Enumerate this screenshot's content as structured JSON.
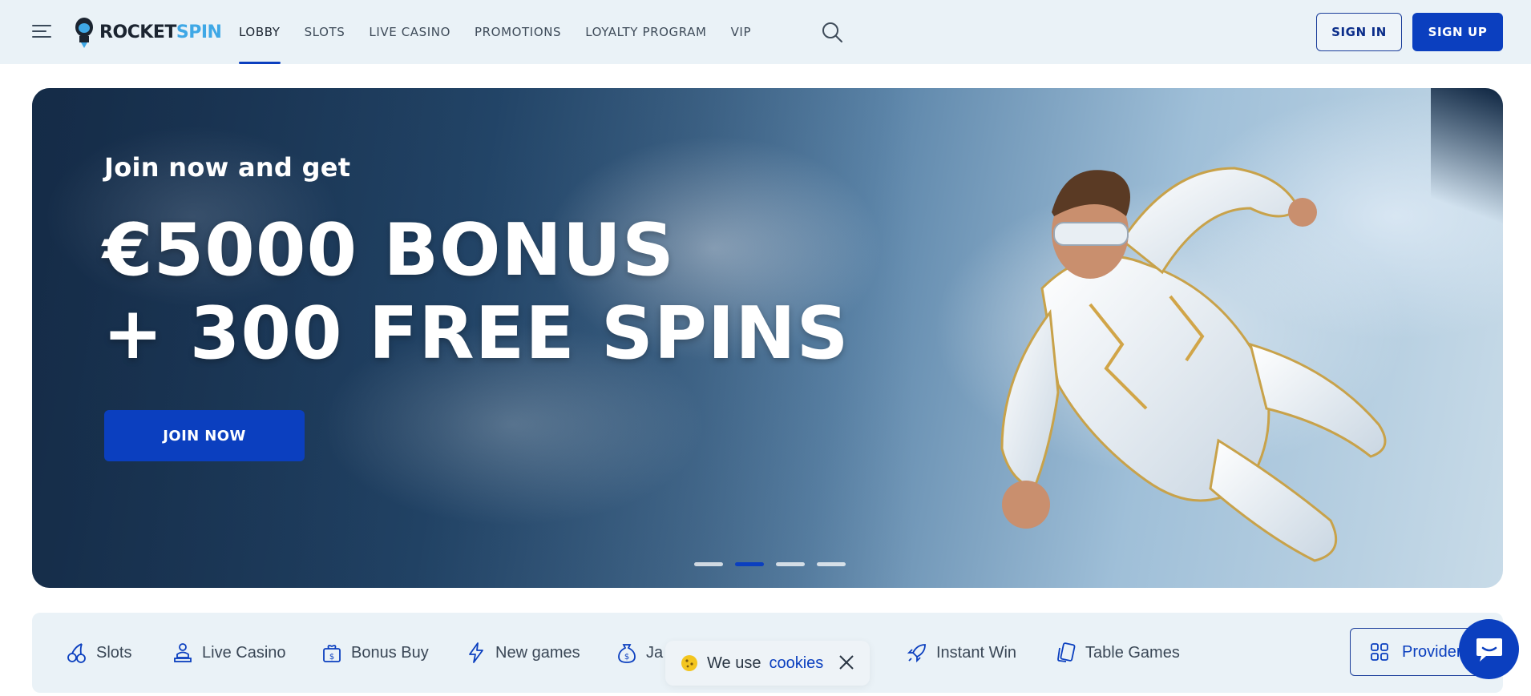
{
  "header": {
    "logo": {
      "part1": "ROCKET",
      "part2": "SPIN"
    },
    "nav": [
      {
        "label": "LOBBY",
        "active": true
      },
      {
        "label": "SLOTS",
        "active": false
      },
      {
        "label": "LIVE CASINO",
        "active": false
      },
      {
        "label": "PROMOTIONS",
        "active": false
      },
      {
        "label": "LOYALTY PROGRAM",
        "active": false
      },
      {
        "label": "VIP",
        "active": false
      }
    ],
    "signin_label": "SIGN IN",
    "signup_label": "SIGN UP"
  },
  "hero": {
    "subtitle": "Join now and get",
    "title_line1": "€5000 BONUS",
    "title_line2": "+ 300 FREE SPINS",
    "cta_label": "JOIN NOW",
    "slides": 4,
    "active_slide": 2
  },
  "categories": [
    {
      "label": "Slots",
      "icon": "cherries-icon"
    },
    {
      "label": "Live Casino",
      "icon": "dealer-icon"
    },
    {
      "label": "Bonus Buy",
      "icon": "gift-dollar-icon"
    },
    {
      "label": "New games",
      "icon": "lightning-icon"
    },
    {
      "label": "Ja",
      "icon": "money-bag-icon"
    },
    {
      "label": "Instant Win",
      "icon": "rocket-icon"
    },
    {
      "label": "Table Games",
      "icon": "cards-icon"
    }
  ],
  "providers_label": "Provider",
  "cookie": {
    "text": "We use",
    "link": "cookies"
  },
  "colors": {
    "brand": "#0b3fbf",
    "accent": "#3fa8e6",
    "header_bg": "#eaf2f7"
  }
}
